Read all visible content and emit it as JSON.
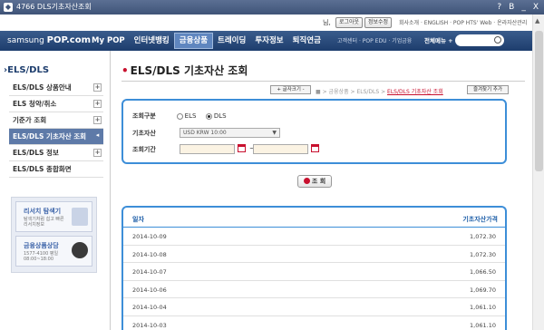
{
  "window": {
    "title": "4766 DLS기초자산조회",
    "controls": [
      "?",
      "B",
      "_",
      "X"
    ]
  },
  "top_util": {
    "user": "님,",
    "logout": "로그아웃",
    "profile": "정보수정",
    "links": "회사소개 · ENGLISH · POP HTS' Web · 온라자산관리"
  },
  "gnb": {
    "logo_prefix": "samsung",
    "logo_main": "POP.com",
    "menu": [
      "My POP",
      "인터넷뱅킹",
      "금융상품",
      "트레이딩",
      "투자정보",
      "퇴직연금"
    ],
    "active_index": 2,
    "sub_links": "고객센터 · POP EDU · 기업금융",
    "all_menu": "전체메뉴 +"
  },
  "lnb": {
    "title": "ELS/DLS",
    "items": [
      {
        "label": "ELS/DLS 상품안내",
        "plus": "+"
      },
      {
        "label": "ELS 청약/취소",
        "plus": "+"
      },
      {
        "label": "기준가 조회",
        "plus": "+"
      },
      {
        "label": "ELS/DLS 기초자산 조회",
        "plus": "◂",
        "active": true
      },
      {
        "label": "ELS/DLS 정보",
        "plus": "+"
      },
      {
        "label": "ELS/DLS 종합화면",
        "plus": ""
      }
    ],
    "banner1": {
      "title": "리서치 탐색기",
      "sub": "탐색기처럼 쉽고 빠른 리서치정보"
    },
    "banner2": {
      "title": "금융상품상담",
      "sub": "1577-4100 평일08:00~18:00"
    }
  },
  "content": {
    "title": "ELS/DLS 기초자산 조회",
    "font_button": "+ 글자크기 -",
    "breadcrumb": [
      "금융상품",
      "ELS/DLS"
    ],
    "breadcrumb_current": "ELS/DLS 기초자산 조회",
    "fav_button": "즐겨찾기 추가",
    "search": {
      "type_label": "조회구분",
      "options": [
        "ELS",
        "DLS"
      ],
      "selected": "DLS",
      "asset_label": "기초자산",
      "asset_value": "USD KRW 10:00",
      "period_label": "조회기간",
      "tilde": "~"
    },
    "query_button": "조 회",
    "table": {
      "headers": [
        "일자",
        "기초자산가격"
      ],
      "rows": [
        [
          "2014-10-09",
          "1,072.30"
        ],
        [
          "2014-10-08",
          "1,072.30"
        ],
        [
          "2014-10-07",
          "1,066.50"
        ],
        [
          "2014-10-06",
          "1,069.70"
        ],
        [
          "2014-10-04",
          "1,061.10"
        ],
        [
          "2014-10-03",
          "1,061.10"
        ]
      ]
    }
  }
}
